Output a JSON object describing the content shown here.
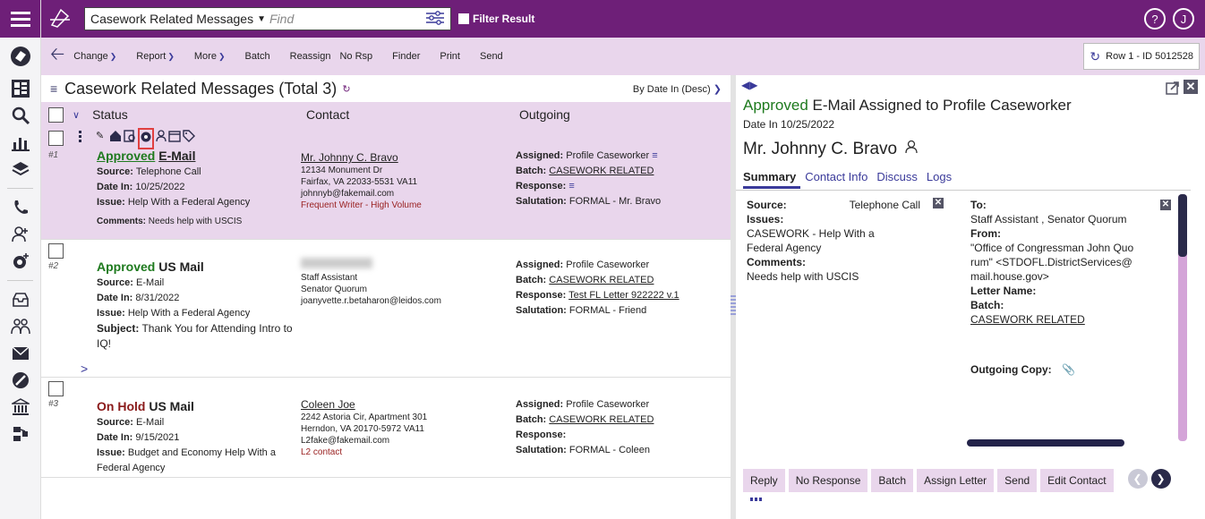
{
  "topbar": {
    "view": "Casework Related Messages",
    "find_placeholder": "Find",
    "filter_label": "Filter Result",
    "help_icon": "?",
    "user_initial": "J"
  },
  "toolbar": {
    "change": "Change",
    "report": "Report",
    "more": "More",
    "batch": "Batch",
    "reassign": "Reassign",
    "no_rsp": "No Rsp",
    "finder": "Finder",
    "print": "Print",
    "send": "Send",
    "row_id": "Row 1 - ID 5012528"
  },
  "list": {
    "title": "Casework Related Messages (Total 3)",
    "sort": "By Date In (Desc)",
    "columns": {
      "status": "Status",
      "contact": "Contact",
      "outgoing": "Outgoing"
    },
    "rows": [
      {
        "num": "#1",
        "status_word": "Approved",
        "type": "E-Mail",
        "source_label": "Source:",
        "source": "Telephone Call",
        "date_label": "Date In:",
        "date": "10/25/2022",
        "issue_label": "Issue:",
        "issue": "Help With a Federal Agency",
        "comments_label": "Comments:",
        "comments": "Needs help with USCIS",
        "contact_name": "Mr. Johnny C. Bravo",
        "addr1": "12134 Monument Dr",
        "addr2": "Fairfax, VA 22033-5531 VA11",
        "email": "johnnyb@fakemail.com",
        "note": "Frequent Writer - High Volume",
        "assigned_label": "Assigned:",
        "assigned": "Profile Caseworker",
        "batch_label": "Batch:",
        "batch": "CASEWORK RELATED",
        "response_label": "Response:",
        "response": "",
        "salutation_label": "Salutation:",
        "salutation": "FORMAL - Mr. Bravo"
      },
      {
        "num": "#2",
        "status_word": "Approved",
        "type": "US Mail",
        "source_label": "Source:",
        "source": "E-Mail",
        "date_label": "Date In:",
        "date": "8/31/2022",
        "issue_label": "Issue:",
        "issue": "Help With a Federal Agency",
        "subject_label": "Subject:",
        "subject": "Thank You for Attending Intro to IQ!",
        "contact_title": "Staff Assistant",
        "contact_org": "Senator Quorum",
        "email": "joanyvette.r.betaharon@leidos.com",
        "assigned_label": "Assigned:",
        "assigned": "Profile Caseworker",
        "batch_label": "Batch:",
        "batch": "CASEWORK RELATED",
        "response_label": "Response:",
        "response": "Test FL Letter 922222 v.1",
        "salutation_label": "Salutation:",
        "salutation": "FORMAL - Friend",
        "expand": ">"
      },
      {
        "num": "#3",
        "status_word": "On Hold",
        "type": "US Mail",
        "source_label": "Source:",
        "source": "E-Mail",
        "date_label": "Date In:",
        "date": "9/15/2021",
        "issue_label": "Issue:",
        "issue": "Budget and Economy Help With a Federal Agency",
        "contact_name": "Coleen Joe",
        "addr1": "2242 Astoria Cir, Apartment 301",
        "addr2": "Herndon, VA 20170-5972 VA11",
        "email": "L2fake@fakemail.com",
        "note": "L2 contact",
        "assigned_label": "Assigned:",
        "assigned": "Profile Caseworker",
        "batch_label": "Batch:",
        "batch": "CASEWORK RELATED",
        "response_label": "Response:",
        "response": "",
        "salutation_label": "Salutation:",
        "salutation": "FORMAL - Coleen"
      }
    ]
  },
  "detail": {
    "status_word": "Approved",
    "title_rest": "E-Mail Assigned to Profile Caseworker",
    "date": "Date In 10/25/2022",
    "name": "Mr. Johnny C. Bravo",
    "tabs": [
      "Summary",
      "Contact Info",
      "Discuss",
      "Logs"
    ],
    "source_label": "Source:",
    "source": "Telephone Call",
    "issues_label": "Issues:",
    "issues": "CASEWORK - Help With a Federal Agency",
    "comments_label": "Comments:",
    "comments": "Needs help with USCIS",
    "to_label": "To:",
    "to": "Staff Assistant , Senator Quorum",
    "from_label": "From:",
    "from": "\"Office of Congressman John Quorum\" <STDOFL.DistrictServices@mail.house.gov>",
    "letter_label": "Letter Name:",
    "batch_label": "Batch:",
    "batch": "CASEWORK RELATED",
    "outgoing_label": "Outgoing Copy:",
    "actions": [
      "Reply",
      "No Response",
      "Batch",
      "Assign Letter",
      "Send",
      "Edit Contact"
    ]
  },
  "colors": {
    "purple": "#6e1f78",
    "lavender": "#e9d6ec",
    "green": "#1e7a1e",
    "red": "#8a1a1a"
  }
}
